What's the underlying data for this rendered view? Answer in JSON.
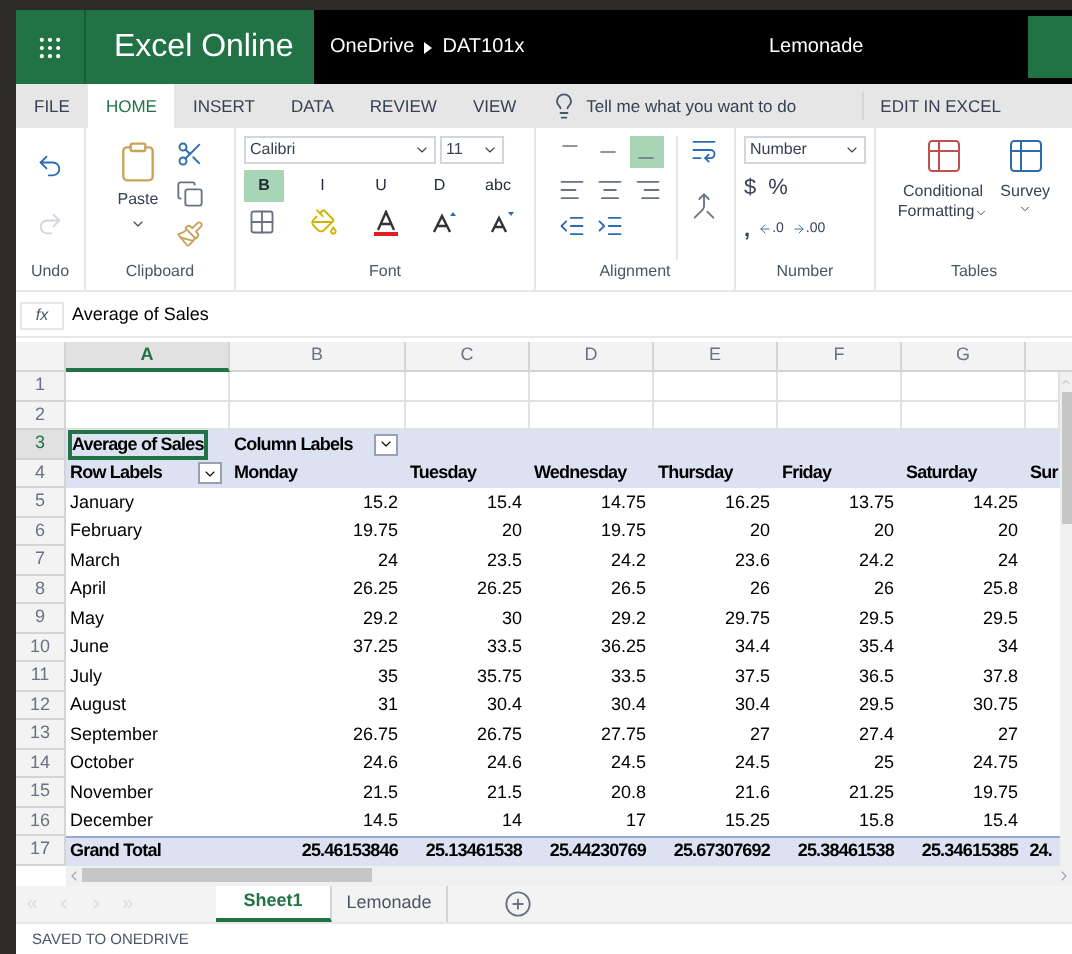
{
  "header": {
    "app_name": "Excel Online",
    "breadcrumb": [
      "OneDrive",
      "DAT101x"
    ],
    "document_title": "Lemonade"
  },
  "tabs": [
    {
      "label": "FILE",
      "selected": false
    },
    {
      "label": "HOME",
      "selected": true
    },
    {
      "label": "INSERT",
      "selected": false
    },
    {
      "label": "DATA",
      "selected": false
    },
    {
      "label": "REVIEW",
      "selected": false
    },
    {
      "label": "VIEW",
      "selected": false
    }
  ],
  "tell_me": {
    "placeholder": "Tell me what you want to do"
  },
  "edit_in_excel": "EDIT IN EXCEL",
  "ribbon": {
    "groups": [
      "Undo",
      "Clipboard",
      "Font",
      "Alignment",
      "Number",
      "Tables"
    ],
    "paste": "Paste",
    "font_name": "Calibri",
    "font_size": "11",
    "font_buttons": [
      {
        "label": "B",
        "selected": true
      },
      {
        "label": "I",
        "selected": false
      },
      {
        "label": "U",
        "selected": false
      },
      {
        "label": "D",
        "selected": false
      },
      {
        "label": "abc",
        "selected": false
      }
    ],
    "align_buttons": [
      {
        "kind": "top",
        "selected": false
      },
      {
        "kind": "middle",
        "selected": false
      },
      {
        "kind": "bottom",
        "selected": true
      }
    ],
    "number_format": "Number",
    "currency": "$",
    "percent": "%",
    "comma": ",",
    "decimals": [
      ".0",
      ".00"
    ],
    "conditional": [
      "Conditional",
      "Formatting"
    ],
    "survey": "Survey"
  },
  "formula_bar": {
    "fx": "fx",
    "value": "Average of Sales"
  },
  "columns": [
    {
      "label": "A",
      "selected": true
    },
    {
      "label": "B",
      "selected": false
    },
    {
      "label": "C",
      "selected": false
    },
    {
      "label": "D",
      "selected": false
    },
    {
      "label": "E",
      "selected": false
    },
    {
      "label": "F",
      "selected": false
    },
    {
      "label": "G",
      "selected": false
    }
  ],
  "rows": [
    {
      "number": "1",
      "kind": "empty",
      "selected": false
    },
    {
      "number": "2",
      "kind": "empty",
      "selected": false
    },
    {
      "number": "3",
      "kind": "header",
      "selected": true,
      "cells": [
        "Average of Sales",
        {
          "text": "Column Labels",
          "filter": true
        }
      ]
    },
    {
      "number": "4",
      "kind": "header",
      "selected": false,
      "cells": [
        {
          "text": "Row Labels",
          "filter": true
        },
        "Monday",
        "Tuesday",
        "Wednesday",
        "Thursday",
        "Friday",
        "Saturday",
        "Sur"
      ]
    },
    {
      "number": "5",
      "kind": "data",
      "selected": false,
      "cells": [
        "January",
        "15.2",
        "15.4",
        "14.75",
        "16.25",
        "13.75",
        "14.25"
      ]
    },
    {
      "number": "6",
      "kind": "data",
      "selected": false,
      "cells": [
        "February",
        "19.75",
        "20",
        "19.75",
        "20",
        "20",
        "20"
      ]
    },
    {
      "number": "7",
      "kind": "data",
      "selected": false,
      "cells": [
        "March",
        "24",
        "23.5",
        "24.2",
        "23.6",
        "24.2",
        "24"
      ]
    },
    {
      "number": "8",
      "kind": "data",
      "selected": false,
      "cells": [
        "April",
        "26.25",
        "26.25",
        "26.5",
        "26",
        "26",
        "25.8"
      ]
    },
    {
      "number": "9",
      "kind": "data",
      "selected": false,
      "cells": [
        "May",
        "29.2",
        "30",
        "29.2",
        "29.75",
        "29.5",
        "29.5"
      ]
    },
    {
      "number": "10",
      "kind": "data",
      "selected": false,
      "cells": [
        "June",
        "37.25",
        "33.5",
        "36.25",
        "34.4",
        "35.4",
        "34"
      ]
    },
    {
      "number": "11",
      "kind": "data",
      "selected": false,
      "cells": [
        "July",
        "35",
        "35.75",
        "33.5",
        "37.5",
        "36.5",
        "37.8"
      ]
    },
    {
      "number": "12",
      "kind": "data",
      "selected": false,
      "cells": [
        "August",
        "31",
        "30.4",
        "30.4",
        "30.4",
        "29.5",
        "30.75"
      ]
    },
    {
      "number": "13",
      "kind": "data",
      "selected": false,
      "cells": [
        "September",
        "26.75",
        "26.75",
        "27.75",
        "27",
        "27.4",
        "27"
      ]
    },
    {
      "number": "14",
      "kind": "data",
      "selected": false,
      "cells": [
        "October",
        "24.6",
        "24.6",
        "24.5",
        "24.5",
        "25",
        "24.75"
      ]
    },
    {
      "number": "15",
      "kind": "data",
      "selected": false,
      "cells": [
        "November",
        "21.5",
        "21.5",
        "20.8",
        "21.6",
        "21.25",
        "19.75"
      ]
    },
    {
      "number": "16",
      "kind": "data",
      "selected": false,
      "cells": [
        "December",
        "14.5",
        "14",
        "17",
        "15.25",
        "15.8",
        "15.4"
      ]
    },
    {
      "number": "17",
      "kind": "total",
      "selected": false,
      "cells": [
        "Grand Total",
        "25.46153846",
        "25.13461538",
        "25.44230769",
        "25.67307692",
        "25.38461538",
        "25.34615385",
        "24."
      ]
    }
  ],
  "sheets": [
    {
      "label": "Sheet1",
      "selected": true
    },
    {
      "label": "Lemonade",
      "selected": false
    }
  ],
  "status": "SAVED TO ONEDRIVE"
}
